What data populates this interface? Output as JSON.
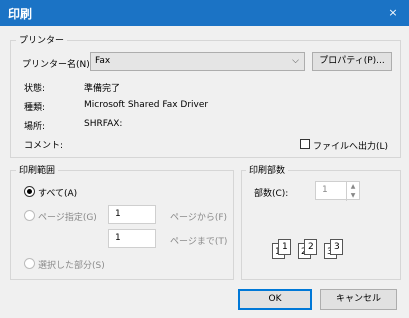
{
  "window": {
    "title": "印刷",
    "close_icon": "×"
  },
  "printer": {
    "group_label": "プリンター",
    "name_label": "プリンター名(N):",
    "name_value": "Fax",
    "properties_button": "プロパティ(P)...",
    "status_label": "状態:",
    "status_value": "準備完了",
    "type_label": "種類:",
    "type_value": "Microsoft Shared Fax Driver",
    "where_label": "場所:",
    "where_value": "SHRFAX:",
    "comment_label": "コメント:",
    "comment_value": "",
    "print_to_file_label": "ファイルへ出力(L)",
    "print_to_file_checked": false
  },
  "range": {
    "group_label": "印刷範囲",
    "all_label": "すべて(A)",
    "pages_label": "ページ指定(G)",
    "from_value": "1",
    "from_label": "ページから(F)",
    "to_value": "1",
    "to_label": "ページまで(T)",
    "selection_label": "選択した部分(S)",
    "selected": "all"
  },
  "copies": {
    "group_label": "印刷部数",
    "count_label": "部数(C):",
    "count_value": "1",
    "collate_pages": [
      "1",
      "1",
      "2",
      "2",
      "3",
      "3"
    ]
  },
  "buttons": {
    "ok": "OK",
    "cancel": "キャンセル"
  }
}
